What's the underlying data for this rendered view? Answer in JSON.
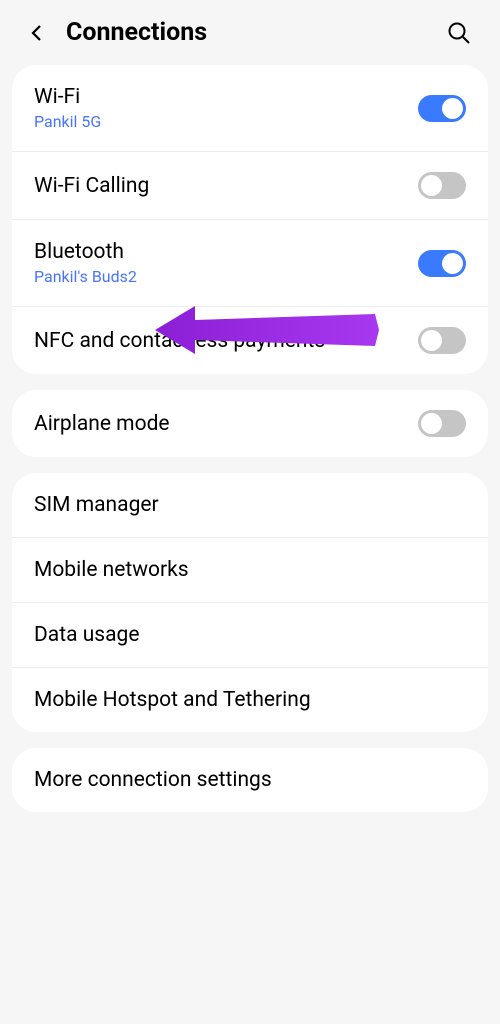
{
  "header": {
    "title": "Connections"
  },
  "group1": {
    "wifi": {
      "label": "Wi-Fi",
      "sub": "Pankil 5G",
      "on": true
    },
    "wifi_calling": {
      "label": "Wi-Fi Calling",
      "on": false
    },
    "bluetooth": {
      "label": "Bluetooth",
      "sub": "Pankil's Buds2",
      "on": true
    },
    "nfc": {
      "label": "NFC and contactless payments",
      "on": false
    }
  },
  "group2": {
    "airplane": {
      "label": "Airplane mode",
      "on": false
    }
  },
  "group3": {
    "sim": {
      "label": "SIM manager"
    },
    "mobile_networks": {
      "label": "Mobile networks"
    },
    "data_usage": {
      "label": "Data usage"
    },
    "hotspot": {
      "label": "Mobile Hotspot and Tethering"
    }
  },
  "group4": {
    "more": {
      "label": "More connection settings"
    }
  }
}
